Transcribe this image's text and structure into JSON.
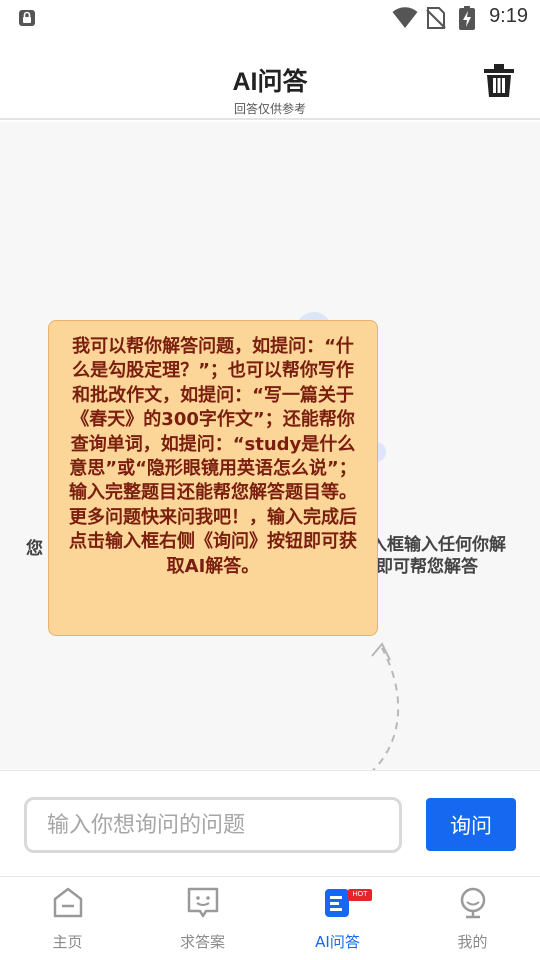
{
  "status_bar": {
    "time": "9:19",
    "icons": [
      "lock-icon",
      "wifi-icon",
      "no-sim-icon",
      "battery-charging-icon"
    ]
  },
  "header": {
    "title": "AI问答",
    "subtitle": "回答仅供参考",
    "trash_icon": "trash-icon"
  },
  "main": {
    "intro_left": "您",
    "intro_right_line1": "入框输入任何你解",
    "intro_right_line2": "即可帮您解答",
    "tip": "我可以帮你解答问题，如提问：“什么是勾股定理？”；也可以帮你写作和批改作文，如提问：“写一篇关于《春天》的300字作文”；还能帮你查询单词，如提问：“study是什么意思”或“隐形眼镜用英语怎么说”；输入完整题目还能帮您解答题目等。更多问题快来问我吧！，输入完成后点击输入框右侧《询问》按钮即可获取AI解答。"
  },
  "input": {
    "placeholder": "输入你想询问的问题",
    "value": "",
    "ask_label": "询问"
  },
  "tabs": [
    {
      "label": "主页",
      "icon": "home-icon",
      "active": false
    },
    {
      "label": "求答案",
      "icon": "message-icon",
      "active": false
    },
    {
      "label": "AI问答",
      "icon": "ai-doc-icon",
      "active": true,
      "badge": "HOT"
    },
    {
      "label": "我的",
      "icon": "profile-icon",
      "active": false
    }
  ],
  "colors": {
    "accent": "#1668f0",
    "tip_background": "#fcd598",
    "tip_text": "#7a1f0f",
    "hot_badge": "#e8232a"
  }
}
